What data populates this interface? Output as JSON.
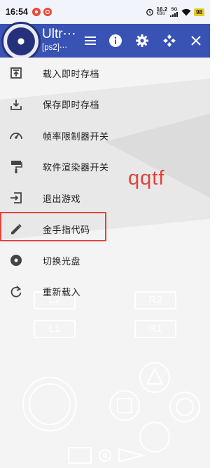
{
  "status_bar": {
    "time": "16:54",
    "net_speed_value": "16.2",
    "net_speed_unit": "KB/s",
    "network_type": "5G",
    "battery_level": "98"
  },
  "header": {
    "title": "Ultr⋯",
    "subtitle": "[ps2]⋯",
    "icons": [
      "menu-icon",
      "info-icon",
      "gear-icon",
      "gamepad-icon",
      "close-icon"
    ]
  },
  "menu": {
    "items": [
      {
        "label": "载入即时存档",
        "icon": "load-state-icon"
      },
      {
        "label": "保存即时存档",
        "icon": "save-state-icon"
      },
      {
        "label": "帧率限制器开关",
        "icon": "speedometer-icon"
      },
      {
        "label": "软件渲染器开关",
        "icon": "paint-roller-icon"
      },
      {
        "label": "退出游戏",
        "icon": "exit-icon"
      },
      {
        "label": "金手指代码",
        "icon": "pencil-icon"
      },
      {
        "label": "切换光盘",
        "icon": "disc-icon"
      },
      {
        "label": "重新载入",
        "icon": "reload-icon"
      }
    ]
  },
  "annotation": {
    "text": "qqtf",
    "color": "#e0443c"
  },
  "controller": {
    "l2": "L2",
    "r2": "R2",
    "l1": "L1",
    "r1": "R1"
  },
  "colors": {
    "header_bg": "#3853b4",
    "highlight": "#e0443c"
  }
}
